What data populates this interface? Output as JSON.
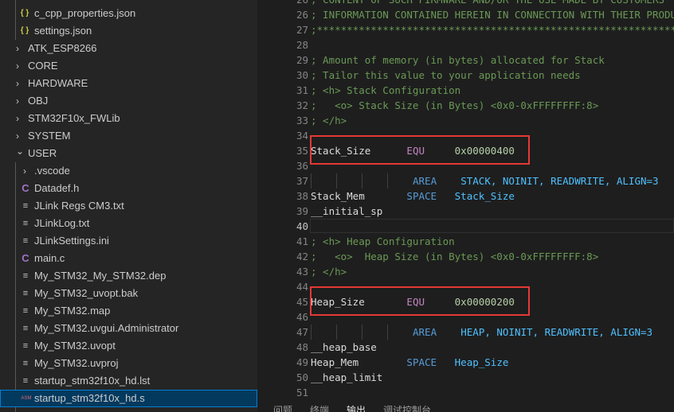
{
  "explorer": {
    "items": [
      {
        "label": "c_cpp_properties.json",
        "type": "json",
        "level": 2
      },
      {
        "label": "settings.json",
        "type": "json",
        "level": 2
      },
      {
        "label": "ATK_ESP8266",
        "type": "folder"
      },
      {
        "label": "CORE",
        "type": "folder"
      },
      {
        "label": "HARDWARE",
        "type": "folder"
      },
      {
        "label": "OBJ",
        "type": "folder"
      },
      {
        "label": "STM32F10x_FWLib",
        "type": "folder"
      },
      {
        "label": "SYSTEM",
        "type": "folder"
      },
      {
        "label": "USER",
        "type": "folder-open"
      },
      {
        "label": ".vscode",
        "type": "folder",
        "level": 1
      },
      {
        "label": "Datadef.h",
        "type": "c"
      },
      {
        "label": "JLink Regs CM3.txt",
        "type": "text"
      },
      {
        "label": "JLinkLog.txt",
        "type": "text"
      },
      {
        "label": "JLinkSettings.ini",
        "type": "text"
      },
      {
        "label": "main.c",
        "type": "c"
      },
      {
        "label": "My_STM32_My_STM32.dep",
        "type": "text"
      },
      {
        "label": "My_STM32_uvopt.bak",
        "type": "text"
      },
      {
        "label": "My_STM32.map",
        "type": "text"
      },
      {
        "label": "My_STM32.uvgui.Administrator",
        "type": "text"
      },
      {
        "label": "My_STM32.uvopt",
        "type": "text"
      },
      {
        "label": "My_STM32.uvproj",
        "type": "text"
      },
      {
        "label": "startup_stm32f10x_hd.lst",
        "type": "text"
      },
      {
        "label": "startup_stm32f10x_hd.s",
        "type": "asm",
        "selected": true
      }
    ],
    "icons": {
      "json": "{ }",
      "c": "C",
      "text": "≡",
      "asm": "ASM",
      "chevron_right": "›",
      "chevron_down": "⌄"
    }
  },
  "editor": {
    "current_line": "40",
    "lines": [
      {
        "n": "26",
        "segs": [
          {
            "c": "cm",
            "t": "; CONTENT OF SUCH FIRMWARE AND/OR THE USE MADE BY CUSTOMERS"
          }
        ]
      },
      {
        "n": "26",
        "segs": [
          {
            "c": "cm",
            "t": "; INFORMATION CONTAINED HEREIN IN CONNECTION WITH THEIR PRODUCTS."
          }
        ]
      },
      {
        "n": "27",
        "segs": [
          {
            "c": "cm",
            "t": ";*******************************************************************************"
          }
        ]
      },
      {
        "n": "28",
        "segs": []
      },
      {
        "n": "29",
        "segs": [
          {
            "c": "cm",
            "t": "; Amount of memory (in bytes) allocated for Stack"
          }
        ]
      },
      {
        "n": "30",
        "segs": [
          {
            "c": "cm",
            "t": "; Tailor this value to your application needs"
          }
        ]
      },
      {
        "n": "31",
        "segs": [
          {
            "c": "cm",
            "t": "; <h> Stack Configuration"
          }
        ]
      },
      {
        "n": "32",
        "segs": [
          {
            "c": "cm",
            "t": ";   <o> Stack Size (in Bytes) <0x0-0xFFFFFFFF:8>"
          }
        ]
      },
      {
        "n": "33",
        "segs": [
          {
            "c": "cm",
            "t": "; </h>"
          }
        ]
      },
      {
        "n": "34",
        "segs": []
      },
      {
        "n": "35",
        "segs": [
          {
            "c": "lbl-c",
            "t": "Stack_Size      "
          },
          {
            "c": "kw",
            "t": "EQU"
          },
          {
            "c": "lbl-c",
            "t": "     "
          },
          {
            "c": "num",
            "t": "0x00000400"
          }
        ]
      },
      {
        "n": "36",
        "segs": []
      },
      {
        "n": "37",
        "indent": 4,
        "segs": [
          {
            "c": "dir",
            "t": "AREA"
          },
          {
            "c": "lbl-c",
            "t": "    "
          },
          {
            "c": "arg",
            "t": "STACK, NOINIT, READWRITE, ALIGN=3"
          }
        ]
      },
      {
        "n": "38",
        "segs": [
          {
            "c": "lbl-c",
            "t": "Stack_Mem       "
          },
          {
            "c": "dir",
            "t": "SPACE"
          },
          {
            "c": "lbl-c",
            "t": "   "
          },
          {
            "c": "arg",
            "t": "Stack_Size"
          }
        ]
      },
      {
        "n": "39",
        "segs": [
          {
            "c": "lbl-c",
            "t": "__initial_sp"
          }
        ]
      },
      {
        "n": "40",
        "segs": []
      },
      {
        "n": "41",
        "segs": [
          {
            "c": "cm",
            "t": "; <h> Heap Configuration"
          }
        ]
      },
      {
        "n": "42",
        "segs": [
          {
            "c": "cm",
            "t": ";   <o>  Heap Size (in Bytes) <0x0-0xFFFFFFFF:8>"
          }
        ]
      },
      {
        "n": "43",
        "segs": [
          {
            "c": "cm",
            "t": "; </h>"
          }
        ]
      },
      {
        "n": "44",
        "segs": []
      },
      {
        "n": "45",
        "segs": [
          {
            "c": "lbl-c",
            "t": "Heap_Size       "
          },
          {
            "c": "kw",
            "t": "EQU"
          },
          {
            "c": "lbl-c",
            "t": "     "
          },
          {
            "c": "num",
            "t": "0x00000200"
          }
        ]
      },
      {
        "n": "46",
        "segs": []
      },
      {
        "n": "47",
        "indent": 4,
        "segs": [
          {
            "c": "dir",
            "t": "AREA"
          },
          {
            "c": "lbl-c",
            "t": "    "
          },
          {
            "c": "arg",
            "t": "HEAP, NOINIT, READWRITE, ALIGN=3"
          }
        ]
      },
      {
        "n": "48",
        "segs": [
          {
            "c": "lbl-c",
            "t": "__heap_base"
          }
        ]
      },
      {
        "n": "49",
        "segs": [
          {
            "c": "lbl-c",
            "t": "Heap_Mem        "
          },
          {
            "c": "dir",
            "t": "SPACE"
          },
          {
            "c": "lbl-c",
            "t": "   "
          },
          {
            "c": "arg",
            "t": "Heap_Size"
          }
        ]
      },
      {
        "n": "50",
        "segs": [
          {
            "c": "lbl-c",
            "t": "__heap_limit"
          }
        ]
      },
      {
        "n": "51",
        "segs": []
      }
    ]
  },
  "panel": {
    "tabs": [
      {
        "label": "问题"
      },
      {
        "label": "终端"
      },
      {
        "label": "输出",
        "active": true
      },
      {
        "label": "调试控制台"
      }
    ]
  },
  "colors": {
    "highlight_box": "#e53935",
    "selection_bg": "#04395e",
    "selection_border": "#007fd4"
  }
}
